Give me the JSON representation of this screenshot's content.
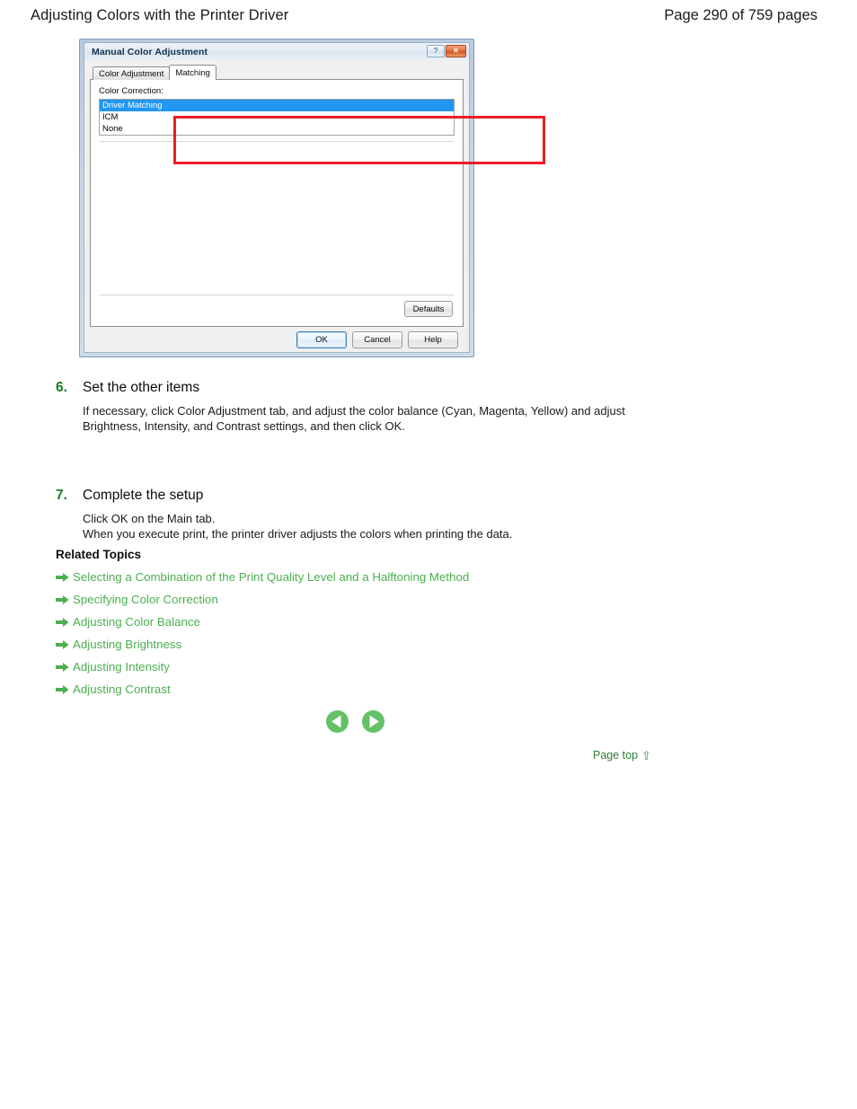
{
  "header": {
    "title": "Adjusting Colors with the Printer Driver",
    "page_info": "Page 290 of 759 pages"
  },
  "dialog": {
    "title": "Manual Color Adjustment",
    "caption_buttons": {
      "help": "?",
      "close": "✕"
    },
    "tabs": [
      {
        "label": "Color Adjustment",
        "active": false
      },
      {
        "label": "Matching",
        "active": true
      }
    ],
    "field_label": "Color Correction:",
    "listbox_options": [
      {
        "label": "Driver Matching",
        "selected": true
      },
      {
        "label": "ICM",
        "selected": false
      },
      {
        "label": "None",
        "selected": false
      }
    ],
    "defaults_button": "Defaults",
    "footer_buttons": [
      {
        "label": "OK",
        "default": true
      },
      {
        "label": "Cancel",
        "default": false
      },
      {
        "label": "Help",
        "default": false
      }
    ],
    "highlight_color": "#ee1c24"
  },
  "steps": [
    {
      "number": "6.",
      "title": "Set the other items",
      "body": "If necessary, click Color Adjustment tab, and adjust the color balance (Cyan, Magenta, Yellow) and adjust Brightness, Intensity, and Contrast settings, and then click OK."
    },
    {
      "number": "7.",
      "title": "Complete the setup",
      "body_line1": "Click OK on the Main tab.",
      "body_line2": "When you execute print, the printer driver adjusts the colors when printing the data."
    }
  ],
  "related": {
    "title": "Related Topics",
    "links": [
      "Selecting a Combination of the Print Quality Level and a Halftoning Method",
      "Specifying Color Correction",
      "Adjusting Color Balance",
      "Adjusting Brightness",
      "Adjusting Intensity",
      "Adjusting Contrast"
    ]
  },
  "navigation": {
    "previous_label": "Previous page",
    "next_label": "Next page"
  },
  "page_top": {
    "label": "Page top",
    "arrow": "⇧"
  },
  "colors": {
    "link_green": "#4caf50",
    "step_number_green": "#1e7a1e",
    "selection_blue": "#2196f3"
  }
}
